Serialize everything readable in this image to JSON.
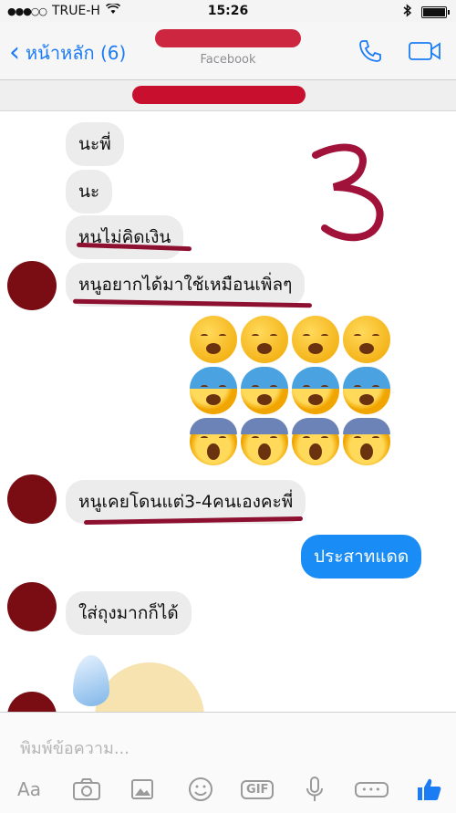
{
  "status_bar": {
    "signal_dots": "●●●○○",
    "carrier": "TRUE-H",
    "time": "15:26"
  },
  "nav": {
    "back_label": "หน้าหลัก (6)",
    "subtitle": "Facebook",
    "accent_color": "#1c7cf4"
  },
  "messages": [
    {
      "from": "them",
      "text": "นะพี่"
    },
    {
      "from": "them",
      "text": "นะ"
    },
    {
      "from": "them",
      "text": "หนูไม่คิดเงิน"
    },
    {
      "from": "them",
      "text": "หนูอยากได้มาใช้เหมือนเพิ่ลๆ"
    },
    {
      "from": "them",
      "text": "หนูเคยโดนแต่3-4คนเองคะพี่"
    },
    {
      "from": "me",
      "text": "ประสาทแดด"
    },
    {
      "from": "them",
      "text": "ใส่ถุงมากก็ได้"
    }
  ],
  "emoji_rows": [
    [
      "weary-face",
      "weary-face",
      "weary-face",
      "weary-face"
    ],
    [
      "anxious-face-with-sweat",
      "anxious-face-with-sweat",
      "anxious-face-with-sweat",
      "anxious-face-with-sweat"
    ],
    [
      "face-screaming-in-fear",
      "face-screaming-in-fear",
      "face-screaming-in-fear",
      "face-screaming-in-fear"
    ]
  ],
  "annotation": "3",
  "composer": {
    "placeholder": "พิมพ์ข้อความ...",
    "aa_label": "Aa",
    "gif_label": "GIF"
  }
}
